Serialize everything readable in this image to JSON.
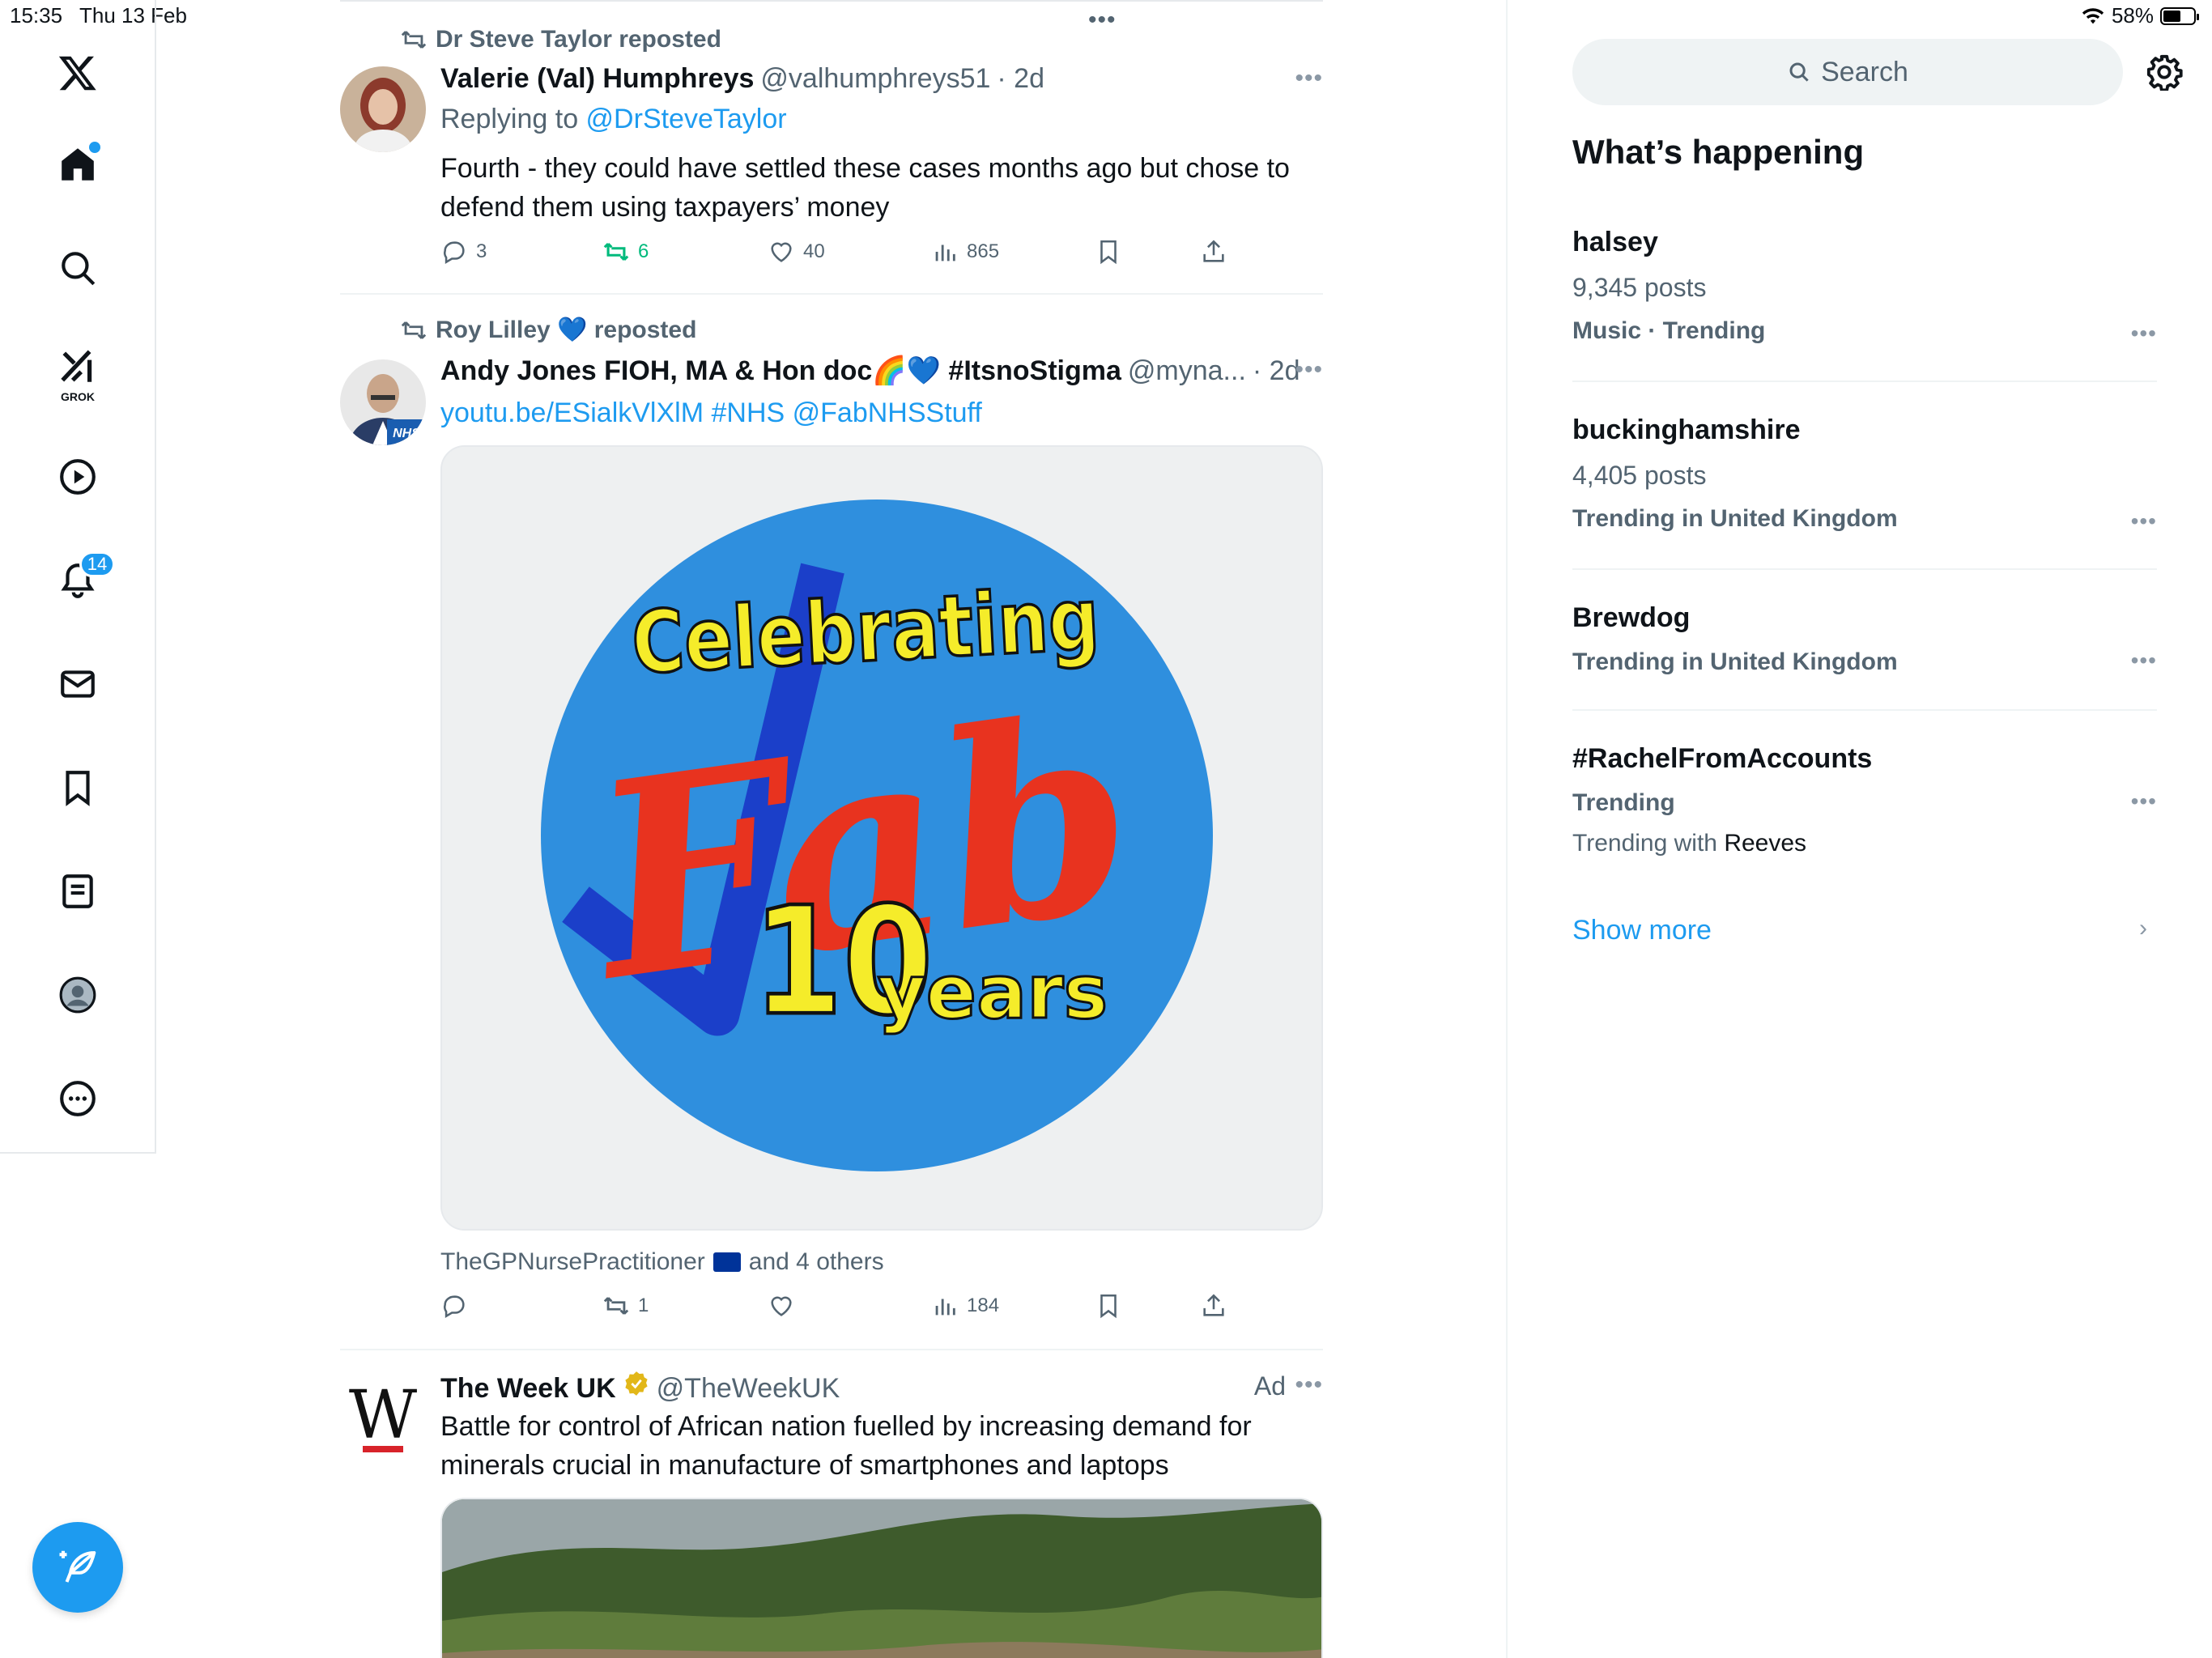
{
  "status_bar": {
    "time": "15:35",
    "date": "Thu 13 Feb",
    "battery": "58%",
    "battery_level": 0.58
  },
  "nav": {
    "items": [
      "home",
      "explore",
      "grok",
      "video",
      "notifications",
      "messages",
      "bookmarks",
      "lists",
      "profile",
      "more"
    ],
    "grok_label": "GROK",
    "notifications_badge": "14"
  },
  "feed": {
    "posts": [
      {
        "repost_by": "Dr Steve Taylor reposted",
        "name": "Valerie (Val) Humphreys",
        "handle": "@valhumphreys51",
        "time": "· 2d",
        "replying_prefix": "Replying to ",
        "replying_to": "@DrSteveTaylor",
        "text": "Fourth - they could have settled these cases months ago but chose to defend them using taxpayers’ money",
        "replies": "3",
        "reposts": "6",
        "likes": "40",
        "views": "865"
      },
      {
        "repost_by": "Roy Lilley 💙 reposted",
        "name": "Andy Jones FIOH, MA & Hon doc🌈💙 #ItsnoStigma",
        "handle": "@myna...",
        "time": "· 2d",
        "avatar_badge": "NHS",
        "links": "youtu.be/ESialkVlXlM #NHS @FabNHSStuff",
        "image_text": {
          "line1": "Celebrating",
          "line2": "Fab",
          "line3": "10",
          "line4": "years"
        },
        "liked_by": "TheGPNursePractitioner",
        "liked_by_more": "and 4 others",
        "replies": "",
        "reposts": "1",
        "likes": "",
        "views": "184"
      },
      {
        "name": "The Week UK",
        "handle": "@TheWeekUK",
        "ad_label": "Ad",
        "avatar_letter": "W",
        "text": "Battle for control of African nation fuelled by increasing demand for minerals crucial in manufacture of smartphones and laptops"
      }
    ]
  },
  "sidebar": {
    "search_placeholder": "Search",
    "title": "What’s happening",
    "trends": [
      {
        "name": "halsey",
        "count": "9,345 posts",
        "meta": "Music · Trending"
      },
      {
        "name": "buckinghamshire",
        "count": "4,405 posts",
        "meta": "Trending in United Kingdom"
      },
      {
        "name": "Brewdog",
        "meta": "Trending in United Kingdom"
      },
      {
        "name": "#RachelFromAccounts",
        "meta": "Trending",
        "with_prefix": "Trending with ",
        "with": "Reeves"
      }
    ],
    "show_more": "Show more"
  },
  "colors": {
    "accent": "#1d9bf0",
    "repost_green": "#00ba7c",
    "text_secondary": "#536471"
  }
}
